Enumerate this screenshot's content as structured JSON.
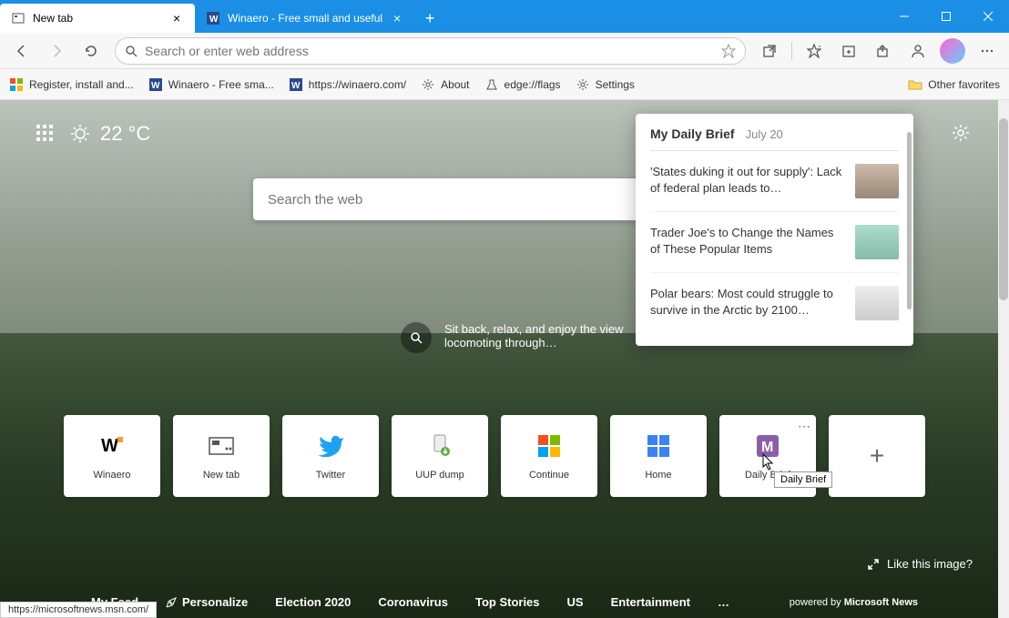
{
  "titlebar": {
    "tabs": [
      {
        "label": "New tab",
        "active": true
      },
      {
        "label": "Winaero - Free small and useful",
        "active": false
      }
    ]
  },
  "toolbar": {
    "address_placeholder": "Search or enter web address"
  },
  "bookmarks": {
    "items": [
      {
        "label": "Register, install and...",
        "icon": "ms"
      },
      {
        "label": "Winaero - Free sma...",
        "icon": "w"
      },
      {
        "label": "https://winaero.com/",
        "icon": "w"
      },
      {
        "label": "About",
        "icon": "gear"
      },
      {
        "label": "edge://flags",
        "icon": "flask"
      },
      {
        "label": "Settings",
        "icon": "gear"
      }
    ],
    "other": "Other favorites"
  },
  "header": {
    "temperature": "22 °C"
  },
  "search": {
    "placeholder": "Search the web"
  },
  "caption": {
    "text": "Sit back, relax, and enjoy the view locomoting through…"
  },
  "brief": {
    "title": "My Daily Brief",
    "date": "July 20",
    "items": [
      "'States duking it out for supply': Lack of federal plan leads to…",
      "Trader Joe's to Change the Names of These Popular Items",
      "Polar bears: Most could struggle to survive in the Arctic by 2100…"
    ]
  },
  "tiles": [
    {
      "label": "Winaero"
    },
    {
      "label": "New tab"
    },
    {
      "label": "Twitter"
    },
    {
      "label": "UUP dump"
    },
    {
      "label": "Continue"
    },
    {
      "label": "Home"
    },
    {
      "label": "Daily Brief"
    }
  ],
  "tile_tooltip": "Daily Brief",
  "like_image": "Like this image?",
  "feed_nav": {
    "items": [
      "My Feed",
      "Personalize",
      "Election 2020",
      "Coronavirus",
      "Top Stories",
      "US",
      "Entertainment",
      "…"
    ],
    "powered_prefix": "powered by ",
    "powered_brand": "Microsoft News"
  },
  "status_url": "https://microsoftnews.msn.com/"
}
